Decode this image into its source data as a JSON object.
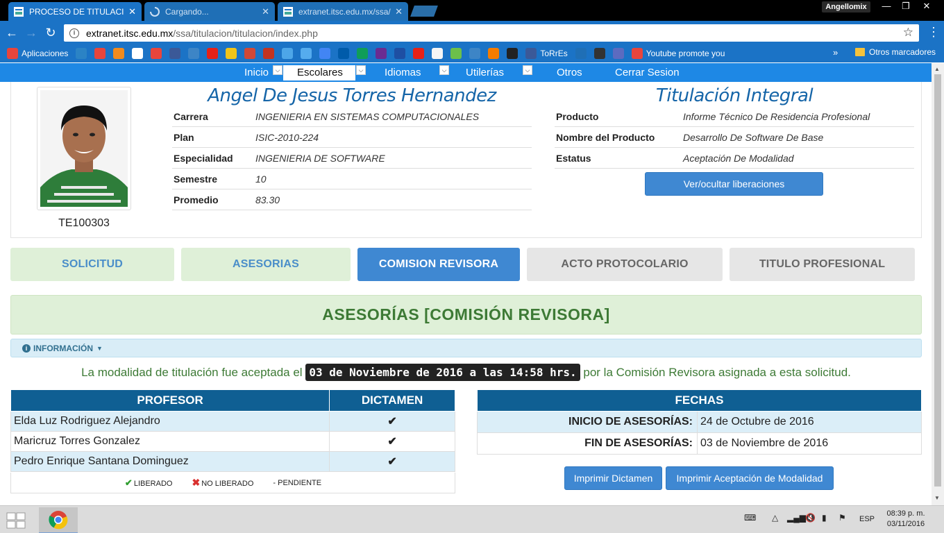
{
  "browser": {
    "tabs": [
      {
        "title": "PROCESO DE TITULACIÓ",
        "close": "✕"
      },
      {
        "title": "Cargando...",
        "close": "✕"
      },
      {
        "title": "extranet.itsc.edu.mx/ssa/",
        "close": "✕"
      }
    ],
    "profile_name": "Angellomix",
    "url_host": "extranet.itsc.edu.mx",
    "url_path": "/ssa/titulacion/titulacion/index.php",
    "bookmarks": [
      {
        "label": "Aplicaciones",
        "color": "#e8453c"
      },
      {
        "label": "",
        "color": "#2b83c5"
      },
      {
        "label": "",
        "color": "#e8453c"
      },
      {
        "label": "",
        "color": "#f28b1e"
      },
      {
        "label": "",
        "color": "#ffffff"
      },
      {
        "label": "",
        "color": "#e8453c"
      },
      {
        "label": "",
        "color": "#3b5998"
      },
      {
        "label": "",
        "color": "#3d85c6"
      },
      {
        "label": "",
        "color": "#e62117"
      },
      {
        "label": "",
        "color": "#f0c419"
      },
      {
        "label": "",
        "color": "#d14836"
      },
      {
        "label": "",
        "color": "#c23321"
      },
      {
        "label": "",
        "color": "#4da6e8"
      },
      {
        "label": "",
        "color": "#55acee"
      },
      {
        "label": "",
        "color": "#4285f4"
      },
      {
        "label": "",
        "color": "#005baa"
      },
      {
        "label": "",
        "color": "#0f9d58"
      },
      {
        "label": "",
        "color": "#6a2c91"
      },
      {
        "label": "",
        "color": "#1e4fa3"
      },
      {
        "label": "",
        "color": "#e62117"
      },
      {
        "label": "",
        "color": "#f5f5f5"
      },
      {
        "label": "",
        "color": "#6cc04a"
      },
      {
        "label": "",
        "color": "#3d85c6"
      },
      {
        "label": "",
        "color": "#f57c00"
      },
      {
        "label": "",
        "color": "#222222"
      },
      {
        "label": "ToRrEs",
        "color": "#3b5998"
      },
      {
        "label": "",
        "color": "#1f6fb6"
      },
      {
        "label": "",
        "color": "#333333"
      },
      {
        "label": "",
        "color": "#5c6bc0"
      },
      {
        "label": "Youtube promote you",
        "color": "#e8453c"
      }
    ],
    "bookmarks_more": "»",
    "other_bookmarks": "Otros marcadores"
  },
  "nav": {
    "items": [
      "Inicio",
      "Escolares",
      "Idiomas",
      "Utilerías",
      "Otros",
      "Cerrar Sesion"
    ],
    "dropdown_glyph": "⌵"
  },
  "student": {
    "name": "Angel De Jesus Torres Hernandez",
    "control_number": "TE100303",
    "fields": [
      {
        "label": "Carrera",
        "value": "INGENIERIA EN SISTEMAS COMPUTACIONALES"
      },
      {
        "label": "Plan",
        "value": "ISIC-2010-224"
      },
      {
        "label": "Especialidad",
        "value": "INGENIERIA DE SOFTWARE"
      },
      {
        "label": "Semestre",
        "value": "10"
      },
      {
        "label": "Promedio",
        "value": "83.30"
      }
    ]
  },
  "titulacion": {
    "title": "Titulación Integral",
    "fields": [
      {
        "label": "Producto",
        "value": "Informe Técnico De Residencia Profesional"
      },
      {
        "label": "Nombre del Producto",
        "value": "Desarrollo De Software De Base"
      },
      {
        "label": "Estatus",
        "value": "Aceptación De Modalidad"
      }
    ],
    "toggle_button": "Ver/ocultar liberaciones"
  },
  "stages": [
    {
      "label": "SOLICITUD",
      "state": "done"
    },
    {
      "label": "ASESORIAS",
      "state": "done"
    },
    {
      "label": "COMISION REVISORA",
      "state": "active"
    },
    {
      "label": "ACTO PROTOCOLARIO",
      "state": "pending"
    },
    {
      "label": "TITULO PROFESIONAL",
      "state": "pending"
    }
  ],
  "section": {
    "banner": "ASESORÍAS [COMISIÓN REVISORA]",
    "info_label": "INFORMACIÓN",
    "message_before": "La modalidad de titulación fue aceptada el",
    "message_date": "03 de Noviembre de 2016 a las 14:58 hrs.",
    "message_after": "por la Comisión Revisora asignada a esta solicitud."
  },
  "professors_table": {
    "headers": [
      "PROFESOR",
      "DICTAMEN"
    ],
    "rows": [
      {
        "name": "Elda Luz Rodriguez Alejandro",
        "status": "✔"
      },
      {
        "name": "Maricruz Torres Gonzalez",
        "status": "✔"
      },
      {
        "name": "Pedro Enrique Santana Dominguez",
        "status": "✔"
      }
    ],
    "legend": {
      "released_glyph": "✔",
      "released": "LIBERADO",
      "not_released_glyph": "✖",
      "not_released": "NO LIBERADO",
      "pending": "- PENDIENTE"
    }
  },
  "dates_table": {
    "header": "FECHAS",
    "rows": [
      {
        "label": "INICIO DE ASESORÍAS:",
        "value": "24 de Octubre de 2016"
      },
      {
        "label": "FIN DE ASESORÍAS:",
        "value": "03 de Noviembre de 2016"
      }
    ]
  },
  "actions": {
    "print_dictamen": "Imprimir Dictamen",
    "print_acceptance": "Imprimir Aceptación de Modalidad"
  },
  "taskbar": {
    "language": "ESP",
    "time": "08:39 p. m.",
    "date": "03/11/2016"
  },
  "colors": {
    "accent": "#1e88e5",
    "table_header": "#0f5f93",
    "success": "#3d7a35",
    "danger": "#d9302f"
  }
}
